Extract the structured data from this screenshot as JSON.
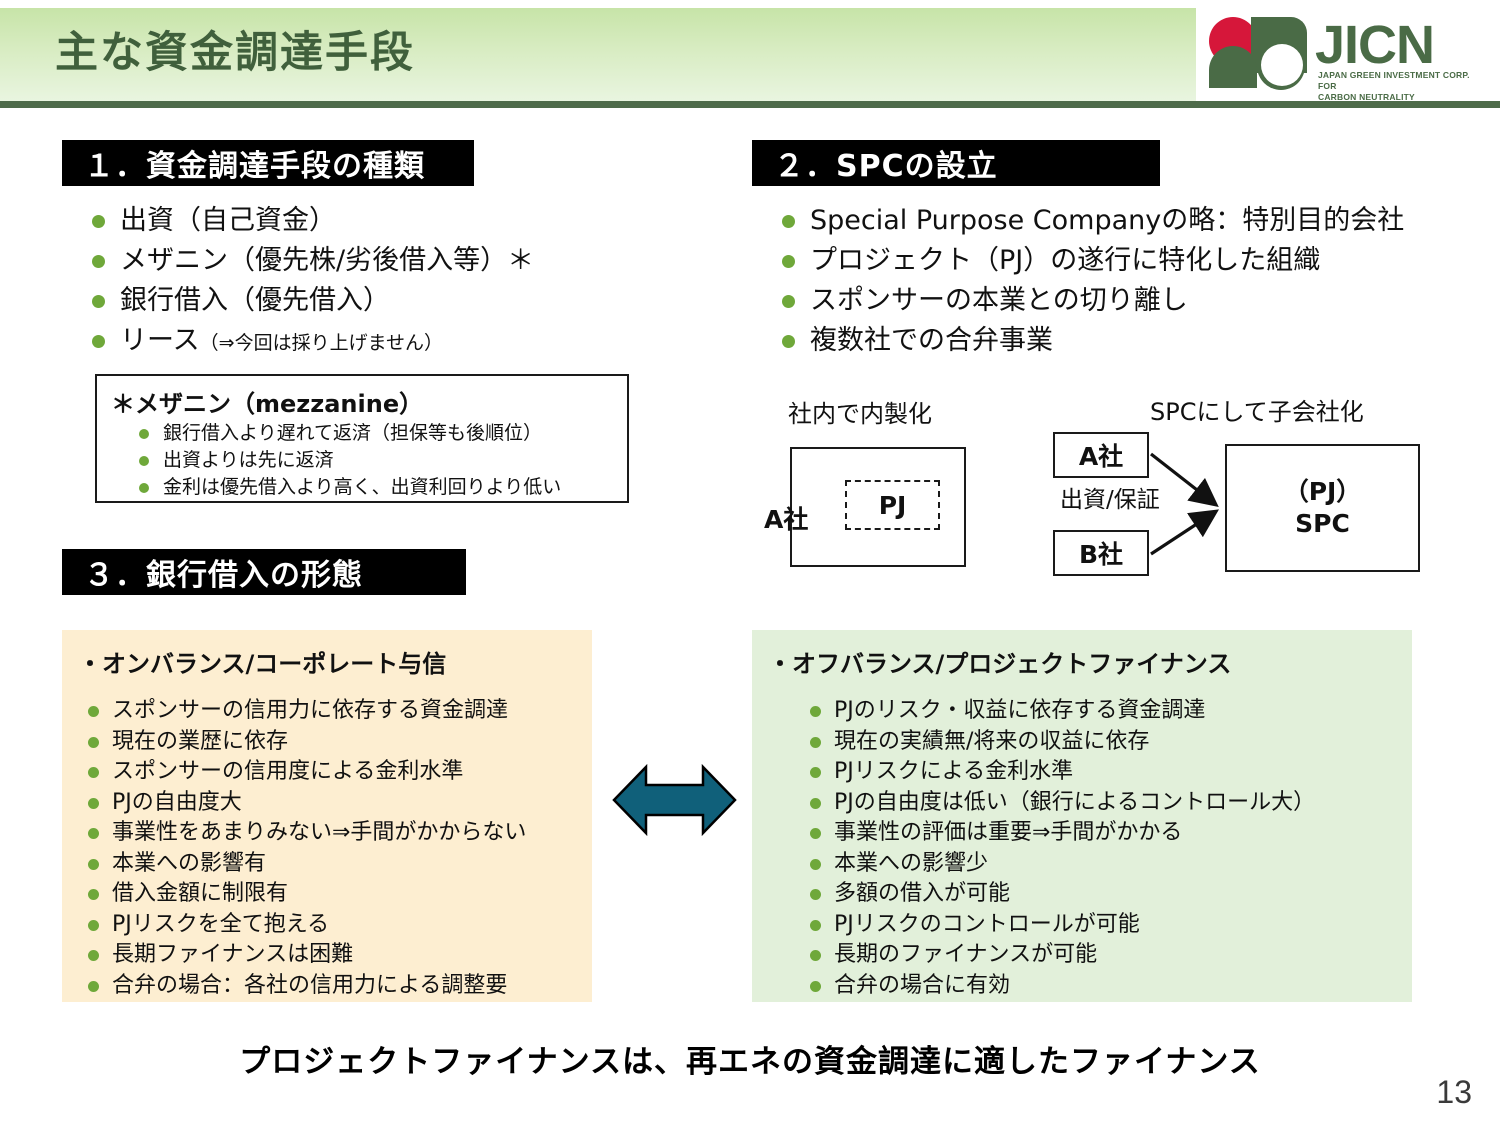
{
  "header": {
    "title": "主な資金調達手段",
    "accent_dark_green": "#40603c",
    "band_gradient_top": "#c7e4a8",
    "band_gradient_bottom": "#e9f5e0",
    "rule_color": "#4e6b4a"
  },
  "logo": {
    "wordmark": "JICN",
    "tagline_line1": "JAPAN GREEN INVESTMENT CORP. FOR",
    "tagline_line2": "CARBON NEUTRALITY",
    "red": "#d6173a",
    "green": "#4a6b46"
  },
  "sections": {
    "s1": {
      "header": "１．資金調達手段の種類"
    },
    "s2": {
      "header": "２．SPCの設立"
    },
    "s3": {
      "header": "３．銀行借入の形態"
    }
  },
  "list1": [
    {
      "text": "出資（自己資金）",
      "note": ""
    },
    {
      "text": "メザニン（優先株/劣後借入等）＊",
      "note": ""
    },
    {
      "text": "銀行借入（優先借入）",
      "note": ""
    },
    {
      "text": "リース",
      "note": "（⇒今回は採り上げません）"
    }
  ],
  "mezzanine": {
    "title": "＊メザニン（mezzanine）",
    "items": [
      "銀行借入より遅れて返済（担保等も後順位）",
      "出資よりは先に返済",
      "金利は優先借入より高く、出資利回りより低い"
    ]
  },
  "list2": [
    "Special Purpose Companyの略：特別目的会社",
    "プロジェクト（PJ）の遂行に特化した組織",
    "スポンサーの本業との切り離し",
    "複数社での合弁事業"
  ],
  "diagram": {
    "caption_left": "社内で内製化",
    "caption_right": "SPCにして子会社化",
    "left_outer_label": "A社",
    "left_inner_label": "PJ",
    "company_a": "A社",
    "company_b": "B社",
    "arrow_label": "出資/保証",
    "spc_line1": "（PJ）",
    "spc_line2": "SPC"
  },
  "comparison": {
    "onbalance": {
      "title": "・オンバランス/コーポレート与信",
      "bg": "#fdeed1",
      "items": [
        "スポンサーの信用力に依存する資金調達",
        "現在の業歴に依存",
        "スポンサーの信用度による金利水準",
        "PJの自由度大",
        "事業性をあまりみない⇒手間がかからない",
        "本業への影響有",
        "借入金額に制限有",
        "PJリスクを全て抱える",
        "長期ファイナンスは困難",
        "合弁の場合：各社の信用力による調整要"
      ]
    },
    "offbalance": {
      "title": "・オフバランス/プロジェクトファイナンス",
      "bg": "#e2f0da",
      "items": [
        "PJのリスク・収益に依存する資金調達",
        "現在の実績無/将来の収益に依存",
        "PJリスクによる金利水準",
        "PJの自由度は低い（銀行によるコントロール大）",
        "事業性の評価は重要⇒手間がかかる",
        "本業への影響少",
        "多額の借入が可能",
        "PJリスクのコントロールが可能",
        "長期のファイナンスが可能",
        "合弁の場合に有効"
      ]
    },
    "arrow_color": "#10607a"
  },
  "conclusion": "プロジェクトファイナンスは、再エネの資金調達に適したファイナンス",
  "page_number": "13"
}
